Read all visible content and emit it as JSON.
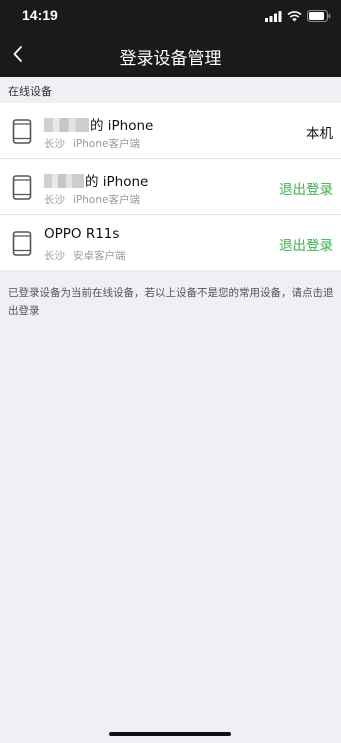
{
  "status_bar": {
    "time": "14:19"
  },
  "nav": {
    "title": "登录设备管理"
  },
  "section": {
    "header": "在线设备"
  },
  "devices": [
    {
      "name_suffix": "的 iPhone",
      "name_obscured": true,
      "location": "长沙",
      "client": "iPhone客户端",
      "action": "本机",
      "action_type": "current"
    },
    {
      "name_suffix": "的 iPhone",
      "name_obscured": true,
      "location": "长沙",
      "client": "iPhone客户端",
      "action": "退出登录",
      "action_type": "logout"
    },
    {
      "name": "OPPO R11s",
      "location": "长沙",
      "client": "安卓客户端",
      "action": "退出登录",
      "action_type": "logout"
    }
  ],
  "footer": {
    "note": "已登录设备为当前在线设备，若以上设备不是您的常用设备，请点击退出登录"
  },
  "colors": {
    "nav_bg": "#1a1a1a",
    "page_bg": "#efeff4",
    "logout": "#39b54a"
  },
  "icons": {
    "back": "chevron-left-icon",
    "device": "phone-icon",
    "signal": "signal-icon",
    "wifi": "wifi-icon",
    "battery": "battery-icon"
  }
}
